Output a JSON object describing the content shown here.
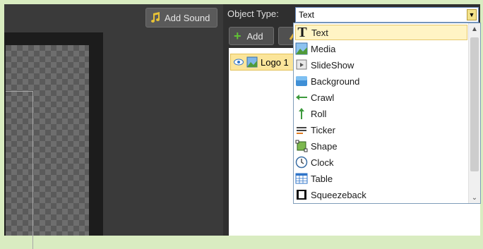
{
  "toolbar": {
    "add_sound_label": "Add Sound"
  },
  "object_panel": {
    "type_label": "Object Type:",
    "selected_type": "Text",
    "add_label": "Add"
  },
  "layers": [
    {
      "label": "Logo 1"
    }
  ],
  "dropdown": {
    "options": [
      "Text",
      "Media",
      "SlideShow",
      "Background",
      "Crawl",
      "Roll",
      "Ticker",
      "Shape",
      "Clock",
      "Table",
      "Squeezeback"
    ]
  },
  "colors": {
    "accent": "#fbe59a",
    "panel_bg": "#2f2f2f",
    "canvas_bg": "#1c1c1c"
  }
}
